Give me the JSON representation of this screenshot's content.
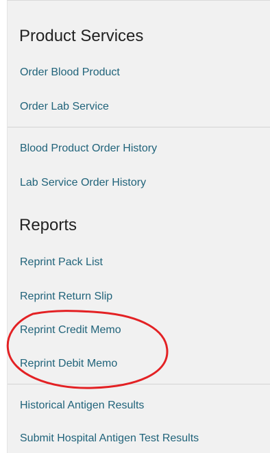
{
  "product_services": {
    "heading": "Product Services",
    "items": [
      {
        "label": "Order Blood Product"
      },
      {
        "label": "Order Lab Service"
      },
      {
        "label": "Blood Product Order History"
      },
      {
        "label": "Lab Service Order History"
      }
    ]
  },
  "reports": {
    "heading": "Reports",
    "items": [
      {
        "label": "Reprint Pack List"
      },
      {
        "label": "Reprint Return Slip"
      },
      {
        "label": "Reprint Credit Memo"
      },
      {
        "label": "Reprint Debit Memo"
      },
      {
        "label": "Historical Antigen Results"
      },
      {
        "label": "Submit Hospital Antigen Test Results"
      }
    ]
  },
  "colors": {
    "link": "#20637a",
    "heading": "#222222",
    "panel_background": "#f1f1f1",
    "divider": "#d4d4d4",
    "annotation_circle": "#e32124"
  }
}
